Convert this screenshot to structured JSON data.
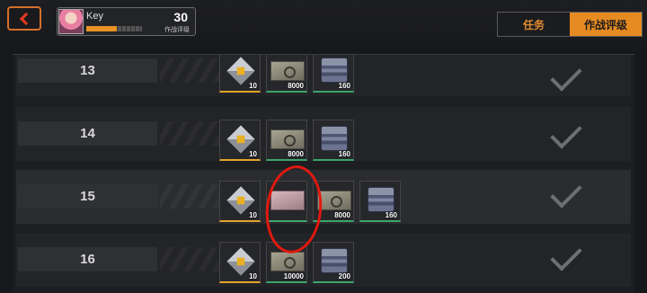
{
  "header": {
    "player_name": "Key",
    "player_level": "30",
    "rating_label": "作战评级",
    "xp_progress": 0.55
  },
  "tabs": [
    {
      "label": "任务",
      "active": false
    },
    {
      "label": "作战评级",
      "active": true
    }
  ],
  "rows": [
    {
      "level": "13",
      "rewards": [
        {
          "icon": "material-cube-icon",
          "qty": "10"
        },
        {
          "icon": "cash-bundle-icon",
          "qty": "8000"
        },
        {
          "icon": "chip-stack-icon",
          "qty": "160"
        }
      ],
      "claimed": true
    },
    {
      "level": "14",
      "rewards": [
        {
          "icon": "material-cube-icon",
          "qty": "10"
        },
        {
          "icon": "cash-bundle-icon",
          "qty": "8000"
        },
        {
          "icon": "chip-stack-icon",
          "qty": "160"
        }
      ],
      "claimed": true
    },
    {
      "level": "15",
      "rewards": [
        {
          "icon": "material-cube-icon",
          "qty": "10"
        },
        {
          "icon": "pink-ticket-icon",
          "qty": ""
        },
        {
          "icon": "cash-bundle-icon",
          "qty": "8000"
        },
        {
          "icon": "chip-stack-icon",
          "qty": "160"
        }
      ],
      "claimed": true
    },
    {
      "level": "16",
      "rewards": [
        {
          "icon": "material-cube-icon",
          "qty": "10"
        },
        {
          "icon": "cash-bundle-icon",
          "qty": "10000"
        },
        {
          "icon": "chip-stack-icon",
          "qty": "200"
        }
      ],
      "claimed": true
    }
  ],
  "colors": {
    "accent": "#e68a22",
    "annotation": "#e1190e"
  }
}
